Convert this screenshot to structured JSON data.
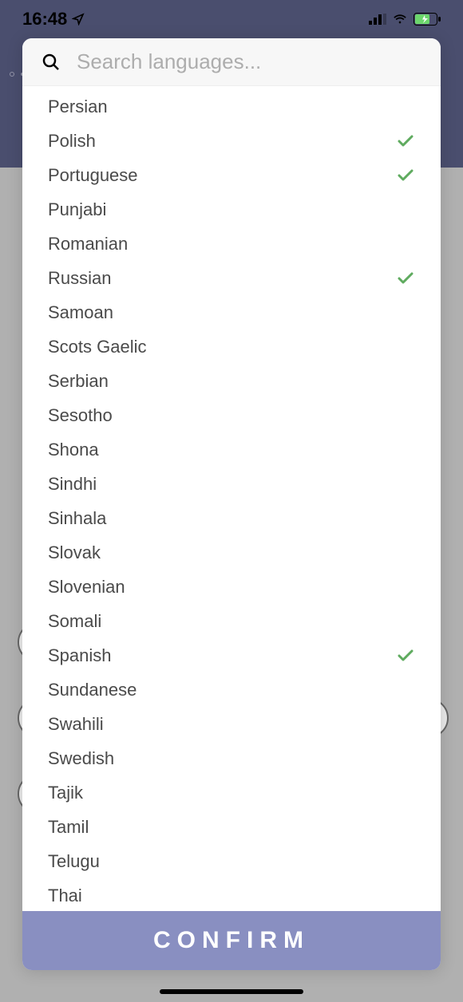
{
  "status": {
    "time": "16:48"
  },
  "search": {
    "placeholder": "Search languages..."
  },
  "languages": [
    {
      "name": "Persian",
      "selected": false
    },
    {
      "name": "Polish",
      "selected": true
    },
    {
      "name": "Portuguese",
      "selected": true
    },
    {
      "name": "Punjabi",
      "selected": false
    },
    {
      "name": "Romanian",
      "selected": false
    },
    {
      "name": "Russian",
      "selected": true
    },
    {
      "name": "Samoan",
      "selected": false
    },
    {
      "name": "Scots Gaelic",
      "selected": false
    },
    {
      "name": "Serbian",
      "selected": false
    },
    {
      "name": "Sesotho",
      "selected": false
    },
    {
      "name": "Shona",
      "selected": false
    },
    {
      "name": "Sindhi",
      "selected": false
    },
    {
      "name": "Sinhala",
      "selected": false
    },
    {
      "name": "Slovak",
      "selected": false
    },
    {
      "name": "Slovenian",
      "selected": false
    },
    {
      "name": "Somali",
      "selected": false
    },
    {
      "name": "Spanish",
      "selected": true
    },
    {
      "name": "Sundanese",
      "selected": false
    },
    {
      "name": "Swahili",
      "selected": false
    },
    {
      "name": "Swedish",
      "selected": false
    },
    {
      "name": "Tajik",
      "selected": false
    },
    {
      "name": "Tamil",
      "selected": false
    },
    {
      "name": "Telugu",
      "selected": false
    },
    {
      "name": "Thai",
      "selected": false
    }
  ],
  "confirm_label": "CONFIRM"
}
